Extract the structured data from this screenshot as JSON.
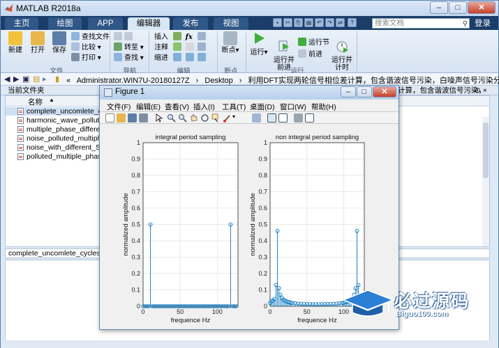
{
  "window": {
    "title": "MATLAB R2018a",
    "controls": [
      "–",
      "□",
      "✕"
    ]
  },
  "tabs": [
    "主页",
    "绘图",
    "APP",
    "编辑器",
    "发布",
    "视图"
  ],
  "active_tab": "编辑器",
  "search": {
    "placeholder": "搜索文档"
  },
  "login": "登录",
  "ribbon": {
    "file_group": {
      "label": "文件",
      "new": "新建",
      "open": "打开",
      "save": "保存",
      "find_files": "查找文件",
      "compare": "比较",
      "print": "打印"
    },
    "nav_group": {
      "label": "导航",
      "goto": "转至",
      "find": "查找"
    },
    "edit_group": {
      "label": "编辑",
      "insert": "插入",
      "comment": "注释",
      "indent": "缩进",
      "fx": "fx"
    },
    "breakpoint_group": {
      "label": "断点",
      "breakpoints": "断点"
    },
    "run_group": {
      "label": "运行",
      "run": "运行",
      "run_advance": "运行并\n前进",
      "run_section": "运行节",
      "advance": "前进",
      "run_time": "运行并\n计时"
    }
  },
  "address": {
    "segments": [
      "«",
      "Administrator.WIN7U-20180127Z",
      "›",
      "Desktop",
      "›",
      "利用DFT实现两轮信号相位差计算，包含谐波信号污染，白噪声信号污染分析"
    ]
  },
  "current_folder": {
    "header": "当前文件夹",
    "name_col": "名称",
    "sort_arrow": "▲"
  },
  "files": [
    "complete_uncomlete_cycles.m",
    "harmonic_wave_polluted.m",
    "multiple_phase_difference.m",
    "noise_polluted_multiple_phase.m",
    "noise_with_different_SRN.m",
    "polluted_multiple_phase.m"
  ],
  "selected_file_index": 0,
  "details_text": "complete_uncomlete_cycles_...",
  "editor_header": {
    "text": "计算，包含谐波信号污染，",
    "ctrl": "⊙ ×"
  },
  "figure": {
    "title": "Figure 1",
    "menu": [
      "文件(F)",
      "编辑(E)",
      "查看(V)",
      "插入(I)",
      "工具(T)",
      "桌面(D)",
      "窗口(W)",
      "帮助(H)"
    ]
  },
  "chart_data": [
    {
      "type": "stem",
      "title": "integral period sampling",
      "xlabel": "frequence Hz",
      "ylabel": "normalized amplitude",
      "xlim": [
        0,
        128
      ],
      "ylim": [
        0,
        1
      ],
      "xticks": [
        0,
        50,
        100
      ],
      "yticks": [
        0,
        0.1,
        0.2,
        0.3,
        0.4,
        0.5,
        0.6,
        0.7,
        0.8,
        0.9,
        1
      ],
      "grid": true,
      "points": [
        {
          "x": 10,
          "y": 0.5
        },
        {
          "x": 118,
          "y": 0.5
        }
      ],
      "baseline_x_range": [
        0,
        127
      ],
      "baseline_step": 2
    },
    {
      "type": "stem",
      "title": "non integral period sampling",
      "xlabel": "frequence Hz",
      "ylabel": "normalized amplitude",
      "xlim": [
        0,
        128
      ],
      "ylim": [
        0,
        1
      ],
      "xticks": [
        0,
        50,
        100
      ],
      "yticks": [
        0,
        0.1,
        0.2,
        0.3,
        0.4,
        0.5,
        0.6,
        0.7,
        0.8,
        0.9,
        1
      ],
      "grid": true,
      "points": [
        {
          "x": 0,
          "y": 0.02
        },
        {
          "x": 2,
          "y": 0.03
        },
        {
          "x": 4,
          "y": 0.035
        },
        {
          "x": 6,
          "y": 0.045
        },
        {
          "x": 8,
          "y": 0.13
        },
        {
          "x": 10,
          "y": 0.46
        },
        {
          "x": 12,
          "y": 0.11
        },
        {
          "x": 14,
          "y": 0.07
        },
        {
          "x": 16,
          "y": 0.05
        },
        {
          "x": 18,
          "y": 0.04
        },
        {
          "x": 20,
          "y": 0.035
        },
        {
          "x": 22,
          "y": 0.03
        },
        {
          "x": 24,
          "y": 0.027
        },
        {
          "x": 26,
          "y": 0.025
        },
        {
          "x": 28,
          "y": 0.022
        },
        {
          "x": 30,
          "y": 0.02
        },
        {
          "x": 34,
          "y": 0.018
        },
        {
          "x": 38,
          "y": 0.016
        },
        {
          "x": 42,
          "y": 0.015
        },
        {
          "x": 46,
          "y": 0.014
        },
        {
          "x": 50,
          "y": 0.013
        },
        {
          "x": 54,
          "y": 0.013
        },
        {
          "x": 58,
          "y": 0.012
        },
        {
          "x": 62,
          "y": 0.012
        },
        {
          "x": 66,
          "y": 0.012
        },
        {
          "x": 70,
          "y": 0.012
        },
        {
          "x": 74,
          "y": 0.013
        },
        {
          "x": 78,
          "y": 0.013
        },
        {
          "x": 82,
          "y": 0.014
        },
        {
          "x": 86,
          "y": 0.015
        },
        {
          "x": 90,
          "y": 0.016
        },
        {
          "x": 94,
          "y": 0.018
        },
        {
          "x": 98,
          "y": 0.02
        },
        {
          "x": 100,
          "y": 0.022
        },
        {
          "x": 102,
          "y": 0.025
        },
        {
          "x": 104,
          "y": 0.027
        },
        {
          "x": 106,
          "y": 0.03
        },
        {
          "x": 108,
          "y": 0.035
        },
        {
          "x": 110,
          "y": 0.04
        },
        {
          "x": 112,
          "y": 0.05
        },
        {
          "x": 114,
          "y": 0.07
        },
        {
          "x": 116,
          "y": 0.11
        },
        {
          "x": 118,
          "y": 0.46
        },
        {
          "x": 120,
          "y": 0.13
        },
        {
          "x": 122,
          "y": 0.045
        },
        {
          "x": 124,
          "y": 0.035
        },
        {
          "x": 126,
          "y": 0.03
        }
      ]
    }
  ],
  "watermark": {
    "main": "必过源码",
    "sub": "Biguo100.com"
  },
  "colors": {
    "stem": "#0072bd",
    "tab_bar": "#1b3d69",
    "active_tab": "#d9e6f4"
  }
}
